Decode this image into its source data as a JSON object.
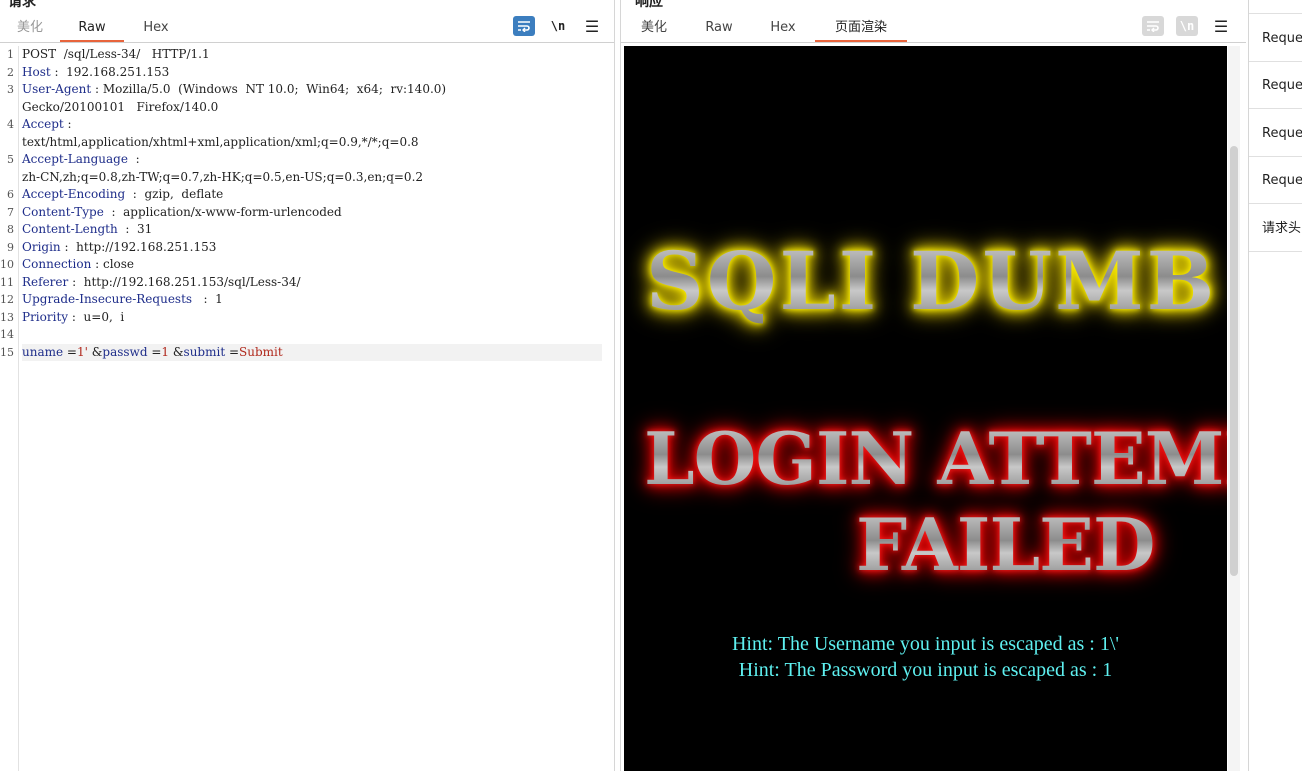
{
  "request": {
    "title": "请求",
    "tabs": [
      {
        "label": "美化",
        "muted": true
      },
      {
        "label": "Raw",
        "active": true
      },
      {
        "label": "Hex"
      }
    ],
    "toolbar": {
      "newline_label": "\\n",
      "menu_label": "☰"
    },
    "lines": [
      {
        "num": "1",
        "parts": [
          {
            "t": "POST  /sql/Less-34/   HTTP/1.1",
            "c": "hv"
          }
        ]
      },
      {
        "num": "2",
        "parts": [
          {
            "t": "Host",
            "c": "hk"
          },
          {
            "t": " :  192.168.251.153",
            "c": "hv"
          }
        ]
      },
      {
        "num": "3",
        "parts": [
          {
            "t": "User-Agent",
            "c": "hk"
          },
          {
            "t": " : Mozilla/5.0  (Windows  NT 10.0;  Win64;  x64;  rv:140.0)",
            "c": "hv"
          }
        ]
      },
      {
        "num": "",
        "parts": [
          {
            "t": "Gecko/20100101   Firefox/140.0",
            "c": "hv"
          }
        ]
      },
      {
        "num": "4",
        "parts": [
          {
            "t": "Accept",
            "c": "hk"
          },
          {
            "t": " :",
            "c": "hv"
          }
        ]
      },
      {
        "num": "",
        "parts": [
          {
            "t": "text/html,application/xhtml+xml,application/xml;q=0.9,*/*;q=0.8",
            "c": "hv"
          }
        ]
      },
      {
        "num": "5",
        "parts": [
          {
            "t": "Accept-Language",
            "c": "hk"
          },
          {
            "t": "  :",
            "c": "hv"
          }
        ]
      },
      {
        "num": "",
        "parts": [
          {
            "t": "zh-CN,zh;q=0.8,zh-TW;q=0.7,zh-HK;q=0.5,en-US;q=0.3,en;q=0.2",
            "c": "hv"
          }
        ]
      },
      {
        "num": "6",
        "parts": [
          {
            "t": "Accept-Encoding",
            "c": "hk"
          },
          {
            "t": "  :  gzip,  deflate",
            "c": "hv"
          }
        ]
      },
      {
        "num": "7",
        "parts": [
          {
            "t": "Content-Type",
            "c": "hk"
          },
          {
            "t": "  :  application/x-www-form-urlencoded",
            "c": "hv"
          }
        ]
      },
      {
        "num": "8",
        "parts": [
          {
            "t": "Content-Length",
            "c": "hk"
          },
          {
            "t": "  :  31",
            "c": "hv"
          }
        ]
      },
      {
        "num": "9",
        "parts": [
          {
            "t": "Origin",
            "c": "hk"
          },
          {
            "t": " :  http://192.168.251.153",
            "c": "hv"
          }
        ]
      },
      {
        "num": "10",
        "parts": [
          {
            "t": "Connection",
            "c": "hk"
          },
          {
            "t": " : close",
            "c": "hv"
          }
        ]
      },
      {
        "num": "11",
        "parts": [
          {
            "t": "Referer",
            "c": "hk"
          },
          {
            "t": " :  http://192.168.251.153/sql/Less-34/",
            "c": "hv"
          }
        ]
      },
      {
        "num": "12",
        "parts": [
          {
            "t": "Upgrade-Insecure-Requests",
            "c": "hk"
          },
          {
            "t": "   :  1",
            "c": "hv"
          }
        ]
      },
      {
        "num": "13",
        "parts": [
          {
            "t": "Priority",
            "c": "hk"
          },
          {
            "t": " :  u=0,  i",
            "c": "hv"
          }
        ]
      },
      {
        "num": "14",
        "parts": []
      },
      {
        "num": "15",
        "current": true,
        "parts": [
          {
            "t": "uname",
            "c": "pk"
          },
          {
            "t": " =",
            "c": "pp"
          },
          {
            "t": "1'",
            "c": "pv"
          },
          {
            "t": " &",
            "c": "pp"
          },
          {
            "t": "passwd",
            "c": "pk"
          },
          {
            "t": " =",
            "c": "pp"
          },
          {
            "t": "1",
            "c": "pv"
          },
          {
            "t": " &",
            "c": "pp"
          },
          {
            "t": "submit",
            "c": "pk"
          },
          {
            "t": " =",
            "c": "pp"
          },
          {
            "t": "Submit",
            "c": "pv"
          }
        ]
      }
    ]
  },
  "response": {
    "title": "响应",
    "tabs": [
      {
        "label": "美化"
      },
      {
        "label": "Raw"
      },
      {
        "label": "Hex"
      },
      {
        "label": "页面渲染",
        "active": true
      }
    ],
    "toolbar": {
      "newline_label": "\\n",
      "menu_label": "☰"
    },
    "render": {
      "banner_top": "SQLI DUMB SERIES",
      "banner_login": "LOGIN ATTEMPT",
      "banner_failed": "FAILED",
      "hint_username": "Hint: The Username you input is escaped as : 1\\'",
      "hint_password": "Hint: The Password you input is escaped as : 1"
    }
  },
  "side_panel": {
    "items": [
      "Request",
      "Request",
      "Request",
      "Request",
      "请求头"
    ]
  },
  "colors": {
    "accent_tab": "#e8643c",
    "wrap_button": "#3c7ebf",
    "header_key": "#1e2d8a",
    "param_value": "#b0281c",
    "hint_text": "#5ef0f0"
  }
}
